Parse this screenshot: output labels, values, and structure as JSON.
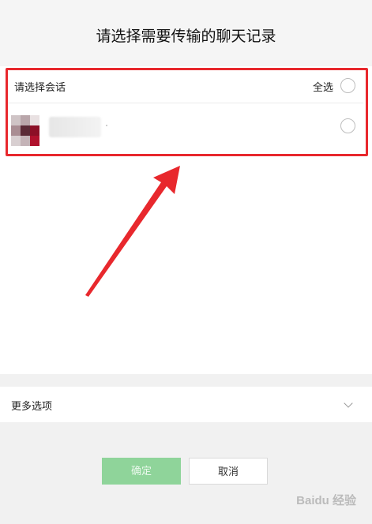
{
  "dialog": {
    "title": "请选择需要传输的聊天记录"
  },
  "session_list": {
    "header_label": "请选择会话",
    "select_all_label": "全选",
    "contacts": [
      {
        "name": ""
      }
    ]
  },
  "more_options": {
    "label": "更多选项"
  },
  "buttons": {
    "confirm_label": "确定",
    "cancel_label": "取消"
  },
  "watermark": {
    "text": "Baidu 经验"
  },
  "colors": {
    "annotation": "#e8282d",
    "confirm_bg": "#8fd49a",
    "panel_bg": "#ffffff",
    "page_bg": "#f1f1f1"
  }
}
